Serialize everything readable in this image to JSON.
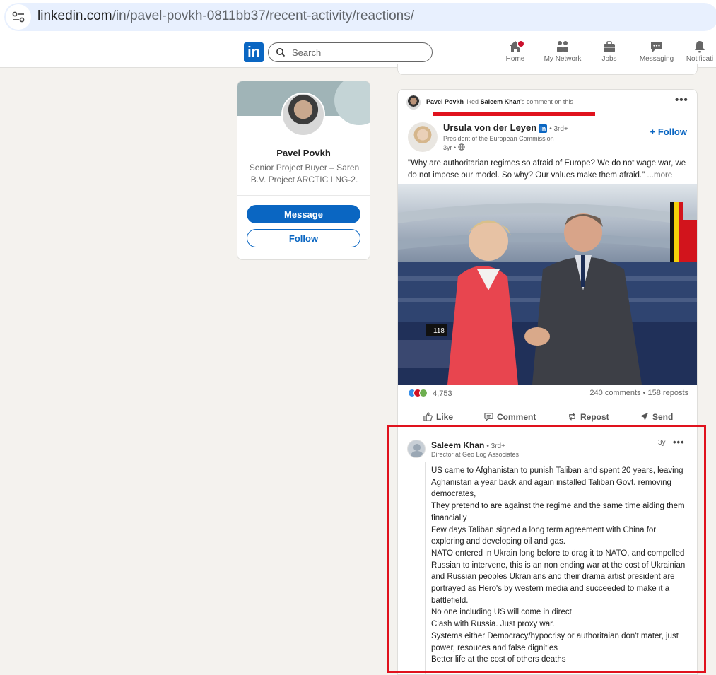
{
  "browser": {
    "url_host": "linkedin.com",
    "url_path": "/in/pavel-povkh-0811bb37/recent-activity/reactions/"
  },
  "header": {
    "logo": "in",
    "search_placeholder": "Search",
    "nav": [
      {
        "label": "Home",
        "icon": "home-icon"
      },
      {
        "label": "My Network",
        "icon": "network-icon"
      },
      {
        "label": "Jobs",
        "icon": "briefcase-icon"
      },
      {
        "label": "Messaging",
        "icon": "chat-icon"
      },
      {
        "label": "Notificati",
        "icon": "bell-icon"
      }
    ]
  },
  "profile_card": {
    "name": "Pavel Povkh",
    "headline": "Senior Project Buyer – Saren B.V. Project ARCTIC LNG-2.",
    "message_label": "Message",
    "follow_label": "Follow"
  },
  "activity": {
    "actor": "Pavel Povkh",
    "verb": "liked",
    "target": "Saleem Khan",
    "suffix": "'s comment on this"
  },
  "post": {
    "author": "Ursula von der Leyen",
    "degree": "• 3rd+",
    "role": "President of the European Commission",
    "time": "3yr •",
    "follow_label": "+ Follow",
    "text": "\"Why are authoritarian regimes so afraid of Europe? We do not wage war, we do not impose our model. So why? Our values make them afraid.\"",
    "more_label": "...more",
    "image_number": "118",
    "reactions_count": "4,753",
    "comments_reposts": "240 comments • 158 reposts",
    "actions": [
      "Like",
      "Comment",
      "Repost",
      "Send"
    ]
  },
  "comment": {
    "author": "Saleem Khan",
    "degree": "• 3rd+",
    "role": "Director at Geo Log Associates",
    "time": "3y",
    "lines": [
      "US came to Afghanistan to punish Taliban and spent 20 years, leaving Aghanistan a year back and again installed Taliban Govt. removing democrates,",
      "They pretend to are against the regime and the same time aiding them financially",
      "Few days Taliban signed a long term agreement with China for exploring and developing oil and gas.",
      "NATO entered in Ukrain long before to drag it to NATO, and compelled Russian to intervene, this is an non ending war at the cost of Ukrainian and Russian peoples Ukranians and their drama artist president are portrayed as Hero's by western media and succeeded to make it a battlefield.",
      "No one including US will come in direct",
      "Clash with Russia. Just proxy war.",
      "Systems either Democracy/hypocrisy or authoritaian don't mater, just power, resouces and false dignities",
      "Better life at the cost of others deaths"
    ]
  },
  "colors": {
    "brand": "#0a66c2",
    "highlight": "#e0121d",
    "page_bg": "#f4f2ee"
  }
}
